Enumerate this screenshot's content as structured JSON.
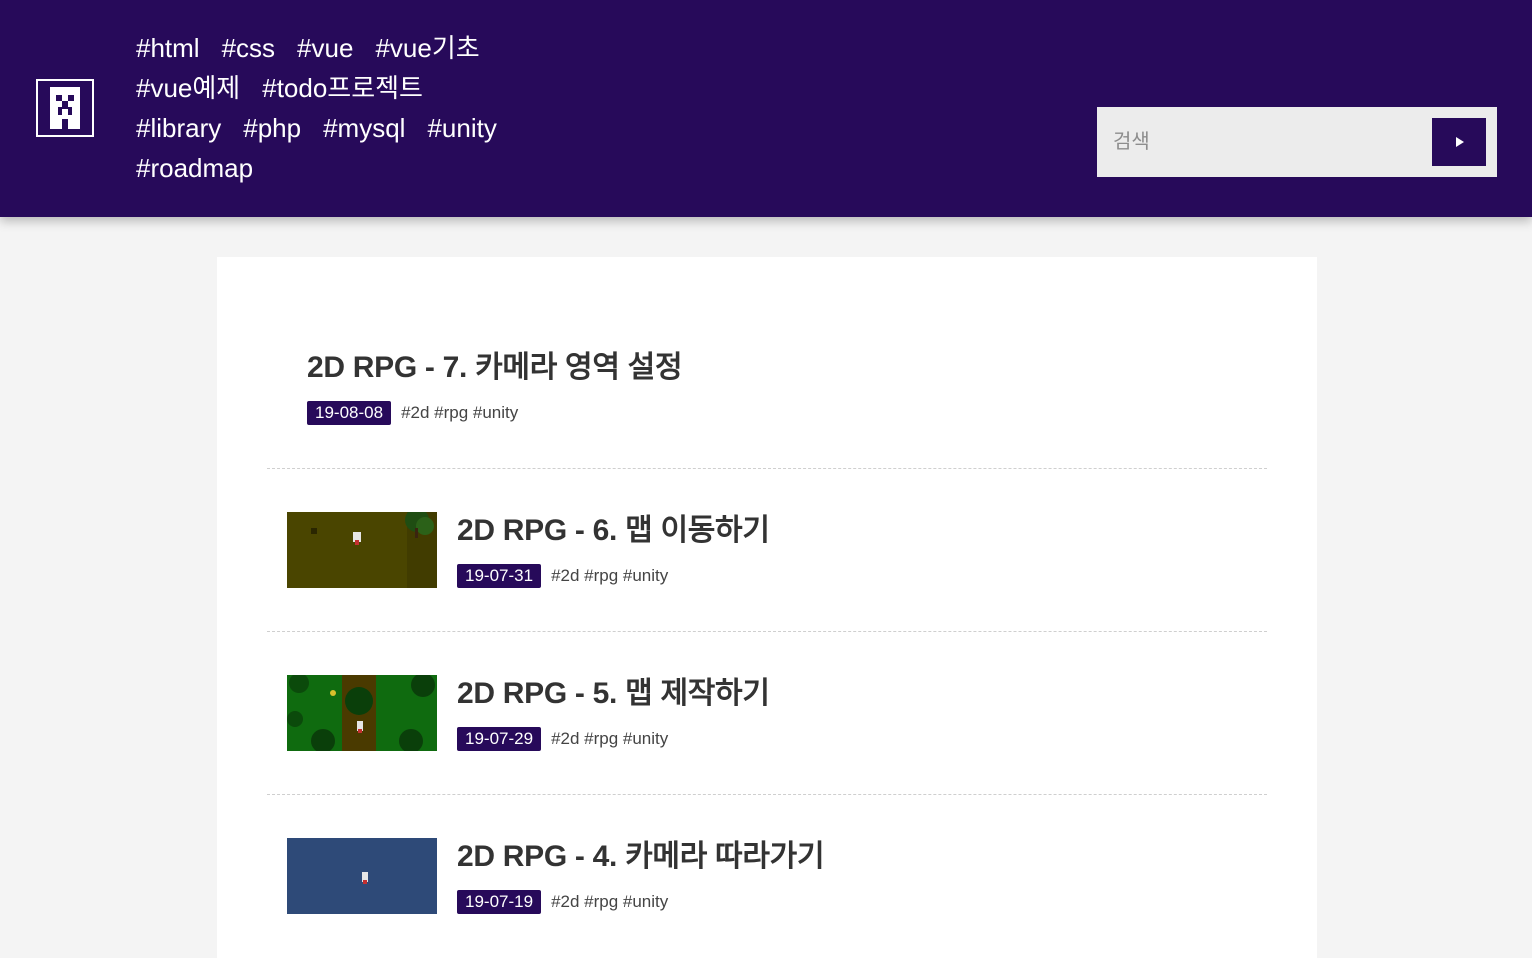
{
  "header": {
    "tag_rows": [
      [
        "#html",
        "#css",
        "#vue",
        "#vue기초"
      ],
      [
        "#vue예제",
        "#todo프로젝트"
      ],
      [
        "#library",
        "#php",
        "#mysql",
        "#unity"
      ],
      [
        "#roadmap"
      ]
    ],
    "search": {
      "placeholder": "검색"
    }
  },
  "posts": [
    {
      "title": "2D RPG - 7. 카메라 영역 설정",
      "date": "19-08-08",
      "tags": "#2d #rpg #unity",
      "thumbnail": null
    },
    {
      "title": "2D RPG - 6. 맵 이동하기",
      "date": "19-07-31",
      "tags": "#2d #rpg #unity",
      "thumbnail": "olive-field-map"
    },
    {
      "title": "2D RPG - 5. 맵 제작하기",
      "date": "19-07-29",
      "tags": "#2d #rpg #unity",
      "thumbnail": "green-forest-map"
    },
    {
      "title": "2D RPG - 4. 카메라 따라가기",
      "date": "19-07-19",
      "tags": "#2d #rpg #unity",
      "thumbnail": "blue-empty-scene"
    }
  ],
  "colors": {
    "header_bg": "#270a5a",
    "date_badge_bg": "#270a5a",
    "page_bg": "#f4f4f4",
    "content_bg": "#ffffff"
  }
}
